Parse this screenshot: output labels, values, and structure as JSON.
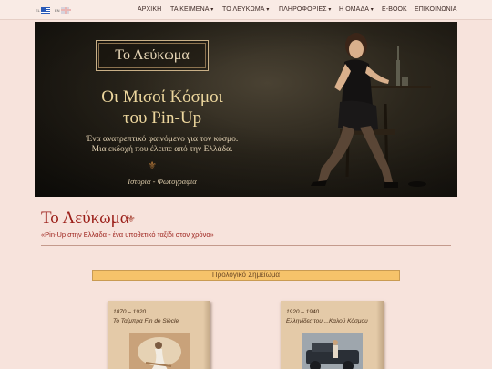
{
  "languages": [
    {
      "code": "EL",
      "name": "Greek"
    },
    {
      "code": "EN",
      "name": "English"
    }
  ],
  "nav": {
    "items": [
      {
        "label": "ΑΡΧΙΚΗ",
        "dropdown": false
      },
      {
        "label": "ΤΑ ΚΕΙΜΕΝΑ",
        "dropdown": true
      },
      {
        "label": "ΤΟ ΛΕΥΚΩΜΑ",
        "dropdown": true
      },
      {
        "label": "ΠΛΗΡΟΦΟΡΙΕΣ",
        "dropdown": true
      },
      {
        "label": "Η ΟΜΑΔΑ",
        "dropdown": true
      },
      {
        "label": "E-BOOK",
        "dropdown": false
      },
      {
        "label": "ΕΠΙΚΟΙΝΩΝΙΑ",
        "dropdown": false
      }
    ]
  },
  "hero": {
    "logo": "Το Λεύκωμα",
    "title_line1": "Οι Μισοί Κόσμοι",
    "title_line2": "του Pin-Up",
    "subtitle_line1": "Ένα ανατρεπτικό φαινόμενο για τον κόσμο.",
    "subtitle_line2": "Μια εκδοχή που έλειπε από την Ελλάδα.",
    "category": "Ιστορία - Φωτογραφία"
  },
  "page": {
    "title": "Το Λεύκωμα",
    "subtitle": "«Pin-Up στην Ελλάδα - ένα υποθετικό ταξίδι στον χρόνο»",
    "prologue_label": "Προλογικό Σημείωμα"
  },
  "cards": [
    {
      "period": "1870 – 1920",
      "title": "Το Ταίμπρα Fin de Siècle"
    },
    {
      "period": "1920 – 1940",
      "title": "Ελληνίδες του ...Καλού Κόσμου"
    }
  ],
  "colors": {
    "background": "#f7e3dc",
    "accent": "#9b1e18",
    "gold": "#ecd69d",
    "button": "#f6c36a"
  },
  "icons": [
    "fleur-de-lis-icon",
    "flag-greek-icon",
    "flag-english-icon",
    "dropdown-caret-icon"
  ]
}
